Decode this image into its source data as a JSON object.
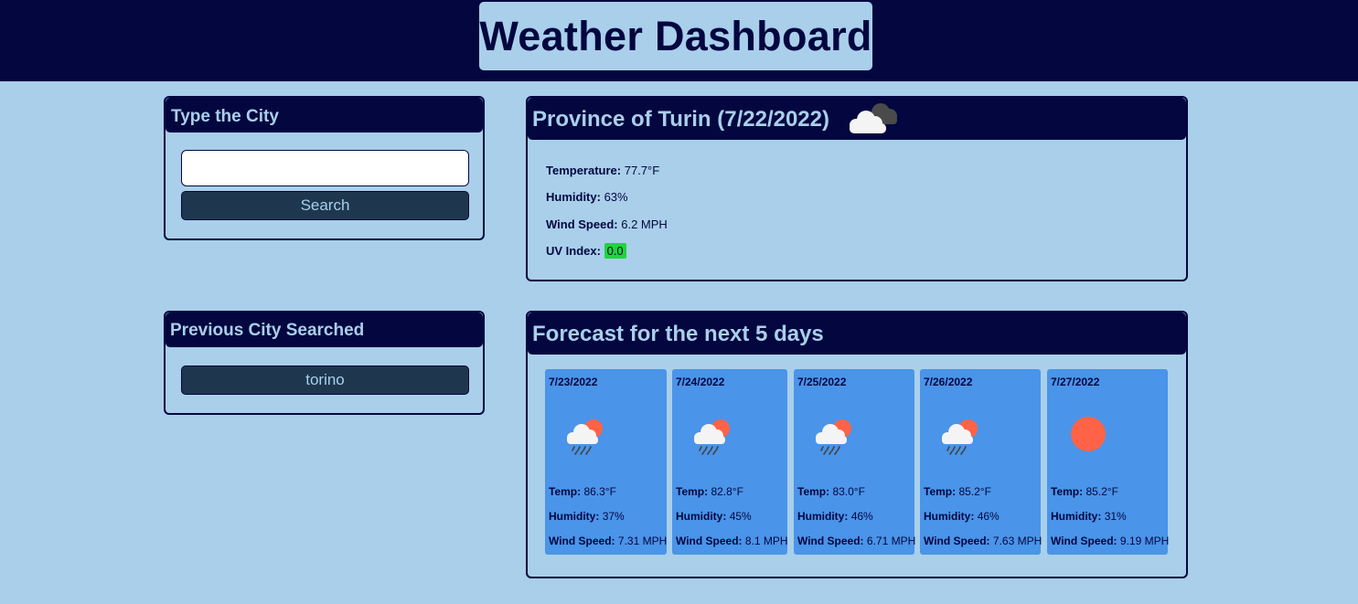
{
  "header": {
    "title": "Weather Dashboard"
  },
  "search": {
    "heading": "Type the City",
    "input_value": "",
    "placeholder": "",
    "button_label": "Search"
  },
  "history": {
    "heading": "Previous City Searched",
    "items": [
      "torino"
    ]
  },
  "current": {
    "title": "Province of Turin (7/22/2022)",
    "icon": "cloudy-icon",
    "temperature_label": "Temperature:",
    "temperature_value": "77.7°F",
    "humidity_label": "Humidity:",
    "humidity_value": "63%",
    "wind_label": "Wind Speed:",
    "wind_value": "6.2 MPH",
    "uv_label": "UV Index:",
    "uv_value": "0.0",
    "uv_color": "#1cd63a"
  },
  "forecast": {
    "heading": "Forecast for the next 5 days",
    "temp_label": "Temp:",
    "humidity_label": "Humidity:",
    "wind_label": "Wind Speed:",
    "days": [
      {
        "date": "7/23/2022",
        "icon": "rain-sun-icon",
        "temp": "86.3°F",
        "humidity": "37%",
        "wind": "7.31 MPH"
      },
      {
        "date": "7/24/2022",
        "icon": "rain-sun-icon",
        "temp": "82.8°F",
        "humidity": "45%",
        "wind": "8.1 MPH"
      },
      {
        "date": "7/25/2022",
        "icon": "rain-sun-icon",
        "temp": "83.0°F",
        "humidity": "46%",
        "wind": "6.71 MPH"
      },
      {
        "date": "7/26/2022",
        "icon": "rain-sun-icon",
        "temp": "85.2°F",
        "humidity": "46%",
        "wind": "7.63 MPH"
      },
      {
        "date": "7/27/2022",
        "icon": "sun-icon",
        "temp": "85.2°F",
        "humidity": "31%",
        "wind": "9.19 MPH"
      }
    ]
  },
  "colors": {
    "page_bg": "#a9cfea",
    "navy": "#03063f",
    "button_bg": "#1e374f",
    "forecast_card_bg": "#4a94e9",
    "sun": "#ff6347"
  }
}
